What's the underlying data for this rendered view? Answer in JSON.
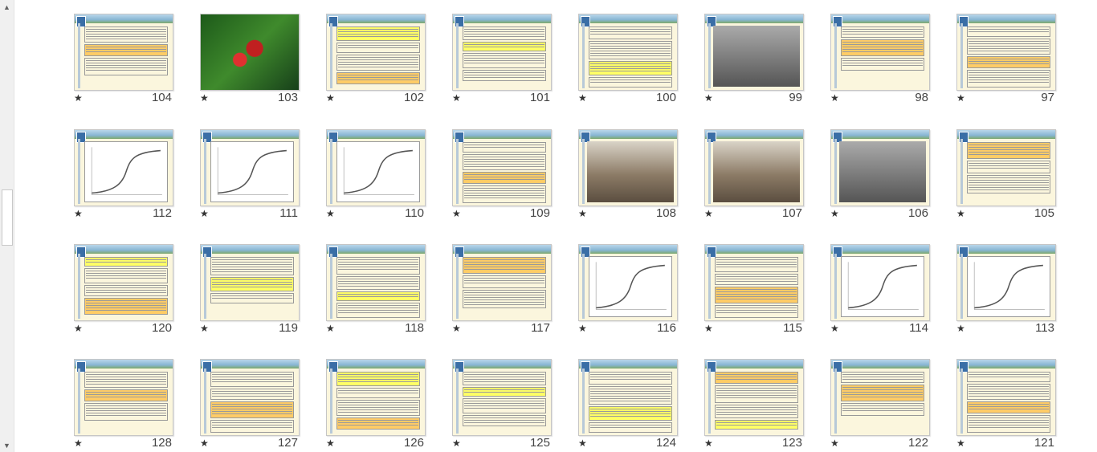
{
  "colors": {
    "thumb_bg": "#fbf6dd",
    "scroll_bg": "#f0f0f0"
  },
  "scrollbar": {
    "up_icon": "triangle-up",
    "down_icon": "triangle-down"
  },
  "slides": [
    [
      {
        "num": "104",
        "star": "★",
        "kind": "text"
      },
      {
        "num": "103",
        "star": "★",
        "kind": "photo-flower"
      },
      {
        "num": "102",
        "star": "★",
        "kind": "text"
      },
      {
        "num": "101",
        "star": "★",
        "kind": "text"
      },
      {
        "num": "100",
        "star": "★",
        "kind": "text"
      },
      {
        "num": "99",
        "star": "★",
        "kind": "photo-dark"
      },
      {
        "num": "98",
        "star": "★",
        "kind": "text"
      },
      {
        "num": "97",
        "star": "★",
        "kind": "text"
      }
    ],
    [
      {
        "num": "112",
        "star": "★",
        "kind": "chart"
      },
      {
        "num": "111",
        "star": "★",
        "kind": "chart"
      },
      {
        "num": "110",
        "star": "★",
        "kind": "chart"
      },
      {
        "num": "109",
        "star": "★",
        "kind": "text"
      },
      {
        "num": "108",
        "star": "★",
        "kind": "photo-lab"
      },
      {
        "num": "107",
        "star": "★",
        "kind": "photo-lab"
      },
      {
        "num": "106",
        "star": "★",
        "kind": "photo-dark"
      },
      {
        "num": "105",
        "star": "★",
        "kind": "text"
      }
    ],
    [
      {
        "num": "120",
        "star": "★",
        "kind": "text"
      },
      {
        "num": "119",
        "star": "★",
        "kind": "text"
      },
      {
        "num": "118",
        "star": "★",
        "kind": "text"
      },
      {
        "num": "117",
        "star": "★",
        "kind": "text"
      },
      {
        "num": "116",
        "star": "★",
        "kind": "chart"
      },
      {
        "num": "115",
        "star": "★",
        "kind": "text"
      },
      {
        "num": "114",
        "star": "★",
        "kind": "chart"
      },
      {
        "num": "113",
        "star": "★",
        "kind": "chart"
      }
    ],
    [
      {
        "num": "128",
        "star": "★",
        "kind": "text"
      },
      {
        "num": "127",
        "star": "★",
        "kind": "text"
      },
      {
        "num": "126",
        "star": "★",
        "kind": "text"
      },
      {
        "num": "125",
        "star": "★",
        "kind": "text"
      },
      {
        "num": "124",
        "star": "★",
        "kind": "text"
      },
      {
        "num": "123",
        "star": "★",
        "kind": "text"
      },
      {
        "num": "122",
        "star": "★",
        "kind": "text"
      },
      {
        "num": "121",
        "star": "★",
        "kind": "text"
      }
    ]
  ]
}
